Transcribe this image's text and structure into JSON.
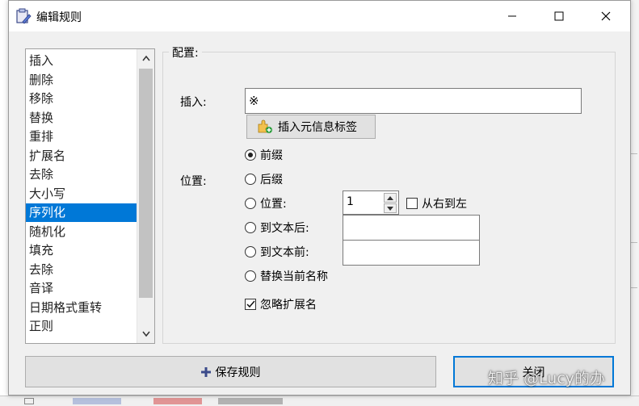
{
  "window": {
    "title": "编辑规则",
    "controls": {
      "minimize": "—",
      "maximize": "☐",
      "close": "✕"
    }
  },
  "rule_list": {
    "items": [
      "插入",
      "删除",
      "移除",
      "替换",
      "重排",
      "扩展名",
      "去除",
      "大小写",
      "序列化",
      "随机化",
      "填充",
      "去除",
      "音译",
      "日期格式重转",
      "正则"
    ],
    "selected_index": 8
  },
  "config": {
    "group_title": "配置:",
    "insert_label": "插入:",
    "insert_value": "※",
    "insert_meta_button": "插入元信息标签",
    "position_label": "位置:",
    "options": {
      "prefix": "前缀",
      "suffix": "后缀",
      "position": "位置:",
      "after_text": "到文本后:",
      "before_text": "到文本前:",
      "replace_name": "替换当前名称"
    },
    "selected_option": "prefix",
    "position_value": "1",
    "right_to_left_label": "从右到左",
    "right_to_left_checked": false,
    "ignore_ext_label": "忽略扩展名",
    "ignore_ext_checked": true
  },
  "buttons": {
    "save": "保存规则",
    "close": "关闭"
  },
  "watermark": "知乎 @Lucy的办",
  "colors": {
    "accent": "#0078d7",
    "dialog_bg": "#f0f0f0"
  }
}
